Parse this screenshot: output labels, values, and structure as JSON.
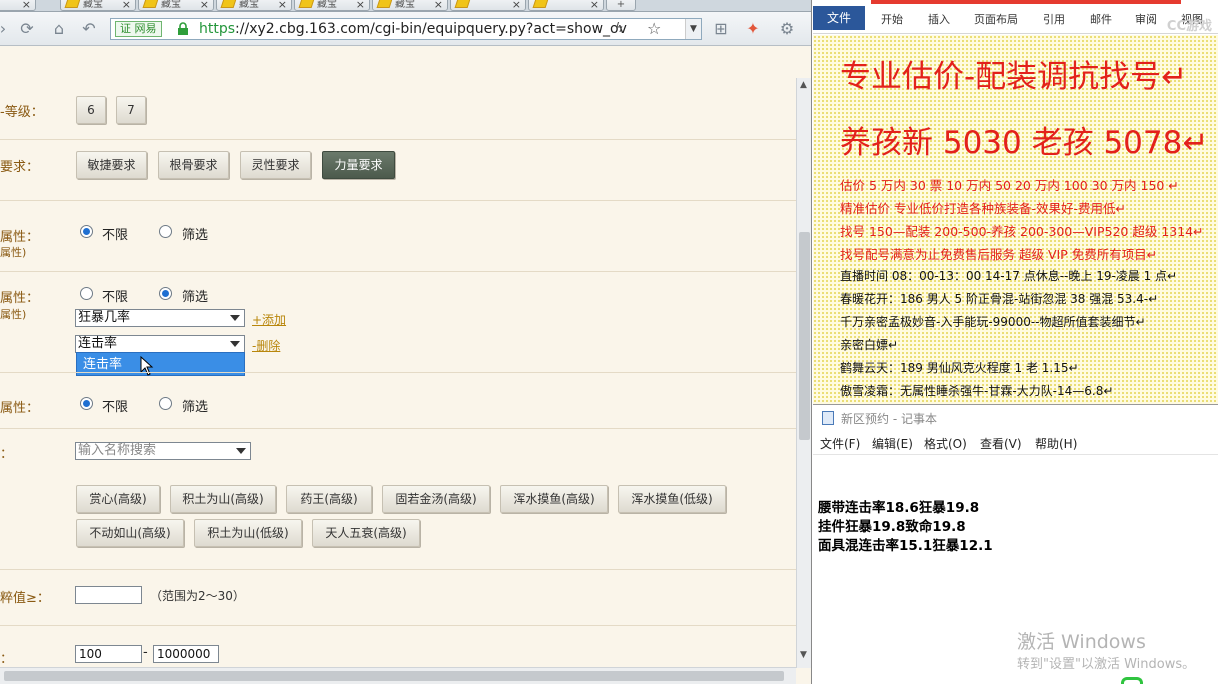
{
  "browser": {
    "tabs": [
      {
        "label": "藏宝",
        "x": 0
      },
      {
        "label": "藏宝",
        "x": 0
      },
      {
        "label": "藏宝",
        "x": 0
      },
      {
        "label": "藏宝",
        "x": 0
      },
      {
        "label": "藏宝",
        "x": 0
      }
    ],
    "url_badge": "证 网易",
    "url_scheme": "https",
    "url_rest": "://xy2.cbg.163.com/cgi-bin/equipquery.py?act=show_ov",
    "rows": {
      "level_label": "-等级：",
      "level_buttons": [
        "6",
        "7"
      ],
      "req_label": "要求：",
      "req_buttons": [
        "敏捷要求",
        "根骨要求",
        "灵性要求",
        "力量要求"
      ],
      "attr1_label": "属性：",
      "attr1_sub": "属性)",
      "attr2_label": "属性：",
      "attr2_sub": "属性)",
      "attr3_label": "属性：",
      "radio_nolimit": "不限",
      "radio_filter": "筛选",
      "select1_value": "狂暴几率",
      "add_link": "+添加",
      "select2_value": "连击率",
      "remove_link": "-删除",
      "dropdown_option": "连击率",
      "search_label": "：",
      "search_placeholder": "输入名称搜索",
      "skills_row1": [
        "赏心(高级)",
        "积土为山(高级)",
        "药王(高级)",
        "固若金汤(高级)",
        "浑水摸鱼(高级)",
        "浑水摸鱼(低级)"
      ],
      "skills_row2": [
        "不动如山(高级)",
        "积土为山(低级)",
        "天人五衰(高级)"
      ],
      "pure_label": "粹值≥：",
      "pure_hint": "（范围为2～30）",
      "price_label": "：",
      "price_min": "100",
      "price_dash": "-",
      "price_max": "1000000"
    }
  },
  "word": {
    "file_tab": "文件",
    "tabs": [
      "开始",
      "插入",
      "页面布局",
      "引用",
      "邮件",
      "审阅",
      "视图"
    ],
    "logo": "CC游戏",
    "lines": [
      "专业估价-配装调抗找号↵",
      "养孩新 5030 老孩 5078↵",
      "估价 5 万内 30 票   10 万内 50  20 万内 100  30 万内 150   ↵",
      "精准估价   专业低价打造各种族装备-效果好-费用低↵",
      "找号 150—配装 200-500-养孩 200-300—VIP520 超级 1314↵",
      "找号配号满意为止免费售后服务    超级 VIP 免费所有项目↵",
      "直播时间 08：00-13：00  14-17 点休息--晚上 19-凌晨 1 点↵",
      "春暖花开：186 男人 5 阶正骨混-站街忽混 38 强混 53.4-↵",
      "千万亲密孟极妙音-入手能玩-99000--物超所值套装细节↵",
      "亲密白嫖↵",
      "鹤舞云天：189 男仙风克火程度 1 老 1.15↵",
      "傲雪凌霜：无属性睡杀强牛-甘霖-大力队-14—6.8↵"
    ]
  },
  "notepad": {
    "title": "新区预约 - 记事本",
    "menu": [
      "文件(F)",
      "编辑(E)",
      "格式(O)",
      "查看(V)",
      "帮助(H)"
    ],
    "lines": [
      "腰带连击率18.6狂暴19.8",
      "挂件狂暴19.8致命19.8",
      "面具混连击率15.1狂暴12.1"
    ],
    "watermark_title": "激活 Windows",
    "watermark_sub": "转到\"设置\"以激活 Windows。"
  }
}
